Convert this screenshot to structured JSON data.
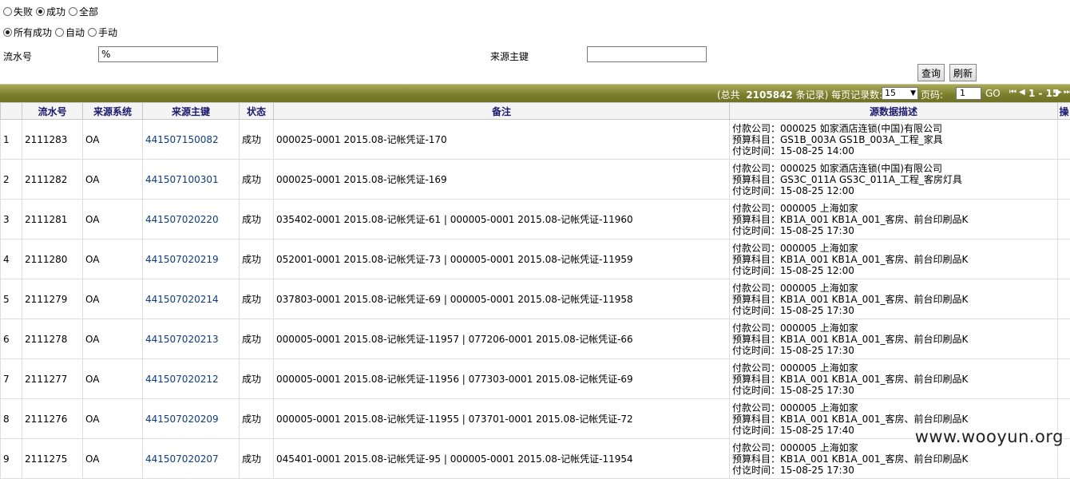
{
  "filters": {
    "status_options": [
      {
        "label": "失败",
        "checked": false
      },
      {
        "label": "成功",
        "checked": true
      },
      {
        "label": "全部",
        "checked": false
      }
    ],
    "mode_options": [
      {
        "label": "所有成功",
        "checked": true
      },
      {
        "label": "自动",
        "checked": false
      },
      {
        "label": "手动",
        "checked": false
      }
    ]
  },
  "search": {
    "serial_label": "流水号",
    "serial_value": "%",
    "source_key_label": "来源主键",
    "source_key_value": "",
    "query_button": "查询",
    "refresh_button": "刷新"
  },
  "pager": {
    "total_prefix": "(总共",
    "total_count": "2105842",
    "total_suffix": "条记录) 每页记录数:",
    "page_size": "15",
    "page_label": "页码:",
    "page_value": "1",
    "go_label": "GO",
    "range": "1 - 15"
  },
  "table": {
    "columns": [
      "",
      "流水号",
      "来源系统",
      "来源主键",
      "状态",
      "备注",
      "源数据描述",
      "操"
    ],
    "rows": [
      {
        "no": "1",
        "serial": "2111283",
        "system": "OA",
        "key": "441507150082",
        "status": "成功",
        "remark": "000025-0001 2015.08-记帐凭证-170",
        "desc": [
          "付款公司：000025 如家酒店连锁(中国)有限公司",
          "预算科目：GS1B_003A GS1B_003A_工程_家具",
          "付讫时间：15-08-25 14:00"
        ]
      },
      {
        "no": "2",
        "serial": "2111282",
        "system": "OA",
        "key": "441507100301",
        "status": "成功",
        "remark": "000025-0001 2015.08-记帐凭证-169",
        "desc": [
          "付款公司：000025 如家酒店连锁(中国)有限公司",
          "预算科目：GS3C_011A GS3C_011A_工程_客房灯具",
          "付讫时间：15-08-25 12:00"
        ]
      },
      {
        "no": "3",
        "serial": "2111281",
        "system": "OA",
        "key": "441507020220",
        "status": "成功",
        "remark": "035402-0001 2015.08-记帐凭证-61 | 000005-0001 2015.08-记帐凭证-11960",
        "desc": [
          "付款公司：000005 上海如家",
          "预算科目：KB1A_001 KB1A_001_客房、前台印刷品K",
          "付讫时间：15-08-25 17:30"
        ]
      },
      {
        "no": "4",
        "serial": "2111280",
        "system": "OA",
        "key": "441507020219",
        "status": "成功",
        "remark": "052001-0001 2015.08-记帐凭证-73 | 000005-0001 2015.08-记帐凭证-11959",
        "desc": [
          "付款公司：000005 上海如家",
          "预算科目：KB1A_001 KB1A_001_客房、前台印刷品K",
          "付讫时间：15-08-25 12:00"
        ]
      },
      {
        "no": "5",
        "serial": "2111279",
        "system": "OA",
        "key": "441507020214",
        "status": "成功",
        "remark": "037803-0001 2015.08-记帐凭证-69 | 000005-0001 2015.08-记帐凭证-11958",
        "desc": [
          "付款公司：000005 上海如家",
          "预算科目：KB1A_001 KB1A_001_客房、前台印刷品K",
          "付讫时间：15-08-25 17:30"
        ]
      },
      {
        "no": "6",
        "serial": "2111278",
        "system": "OA",
        "key": "441507020213",
        "status": "成功",
        "remark": "000005-0001 2015.08-记帐凭证-11957 | 077206-0001 2015.08-记帐凭证-66",
        "desc": [
          "付款公司：000005 上海如家",
          "预算科目：KB1A_001 KB1A_001_客房、前台印刷品K",
          "付讫时间：15-08-25 17:30"
        ]
      },
      {
        "no": "7",
        "serial": "2111277",
        "system": "OA",
        "key": "441507020212",
        "status": "成功",
        "remark": "000005-0001 2015.08-记帐凭证-11956 | 077303-0001 2015.08-记帐凭证-69",
        "desc": [
          "付款公司：000005 上海如家",
          "预算科目：KB1A_001 KB1A_001_客房、前台印刷品K",
          "付讫时间：15-08-25 17:30"
        ]
      },
      {
        "no": "8",
        "serial": "2111276",
        "system": "OA",
        "key": "441507020209",
        "status": "成功",
        "remark": "000005-0001 2015.08-记帐凭证-11955 | 073701-0001 2015.08-记帐凭证-72",
        "desc": [
          "付款公司：000005 上海如家",
          "预算科目：KB1A_001 KB1A_001_客房、前台印刷品K",
          "付讫时间：15-08-25 17:40"
        ]
      },
      {
        "no": "9",
        "serial": "2111275",
        "system": "OA",
        "key": "441507020207",
        "status": "成功",
        "remark": "045401-0001 2015.08-记帐凭证-95 | 000005-0001 2015.08-记帐凭证-11954",
        "desc": [
          "付款公司：000005 上海如家",
          "预算科目：KB1A_001 KB1A_001_客房、前台印刷品K",
          "付讫时间：15-08-25 17:30"
        ]
      }
    ]
  },
  "watermark": "www.wooyun.org"
}
